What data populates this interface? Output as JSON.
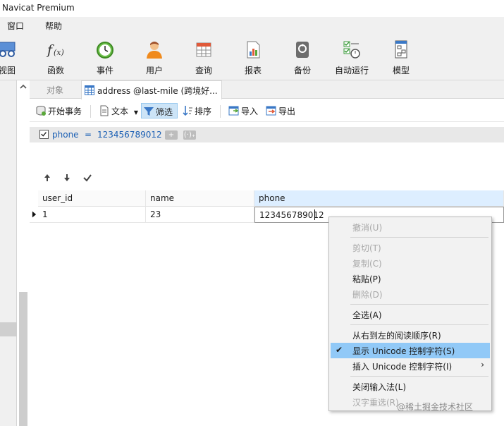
{
  "window": {
    "title": "Navicat Premium"
  },
  "menu": [
    "窗口",
    "帮助"
  ],
  "toolbar": [
    {
      "label": "视图",
      "icon": "view-icon"
    },
    {
      "label": "函数",
      "icon": "function-icon"
    },
    {
      "label": "事件",
      "icon": "event-clock-icon"
    },
    {
      "label": "用户",
      "icon": "user-icon"
    },
    {
      "label": "查询",
      "icon": "query-grid-icon"
    },
    {
      "label": "报表",
      "icon": "report-icon"
    },
    {
      "label": "备份",
      "icon": "backup-icon"
    },
    {
      "label": "自动运行",
      "icon": "automation-icon"
    },
    {
      "label": "模型",
      "icon": "model-icon"
    }
  ],
  "tabs": {
    "objects": "对象",
    "active": "address @last-mile (跨境好..."
  },
  "subtoolbar": {
    "begin_transaction": "开始事务",
    "text": "文本",
    "filter": "筛选",
    "sort": "排序",
    "import": "导入",
    "export": "导出"
  },
  "filter": {
    "field": "phone",
    "operator": "=",
    "value": "123456789012",
    "add": "+",
    "more": "(·)₊"
  },
  "grid": {
    "columns": [
      "user_id",
      "name",
      "phone"
    ],
    "rows": [
      [
        "1",
        "23",
        "123456789012"
      ]
    ]
  },
  "context_menu": {
    "undo": "撤消(U)",
    "cut": "剪切(T)",
    "copy": "复制(C)",
    "paste": "粘贴(P)",
    "delete": "删除(D)",
    "select_all": "全选(A)",
    "rtl": "从右到左的阅读顺序(R)",
    "show_unicode": "显示 Unicode 控制字符(S)",
    "insert_unicode": "插入 Unicode 控制字符(I)",
    "close_ime": "关闭输入法(L)",
    "reconvert": "汉字重选(R)"
  },
  "watermark": "@稀土掘金技术社区",
  "colors": {
    "accent_blue": "#1a5fb4",
    "menu_highlight": "#91c9f7",
    "filter_active": "#cce4f7"
  }
}
